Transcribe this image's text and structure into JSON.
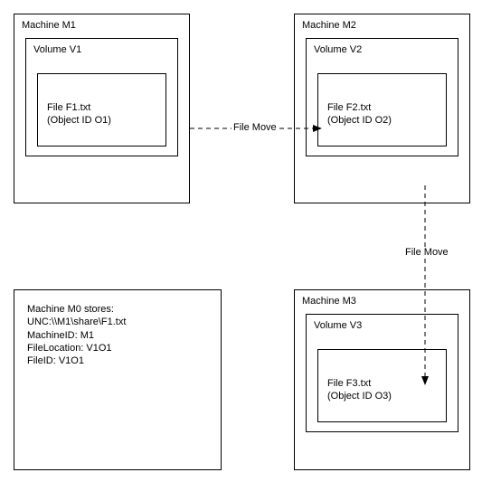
{
  "m1": {
    "title": "Machine M1",
    "volume": "Volume V1",
    "file_name": "File F1.txt",
    "file_obj": "(Object ID O1)"
  },
  "m2": {
    "title": "Machine M2",
    "volume": "Volume V2",
    "file_name": "File F2.txt",
    "file_obj": "(Object ID O2)"
  },
  "m3": {
    "title": "Machine M3",
    "volume": "Volume V3",
    "file_name": "File F3.txt",
    "file_obj": "(Object ID O3)"
  },
  "m0": {
    "line1": "Machine M0 stores:",
    "line2": "UNC:\\\\M1\\share\\F1.txt",
    "line3": "MachineID: M1",
    "line4": "FileLocation: V1O1",
    "line5": "FileID: V1O1"
  },
  "arrows": {
    "move1": "File Move",
    "move2": "File Move"
  }
}
